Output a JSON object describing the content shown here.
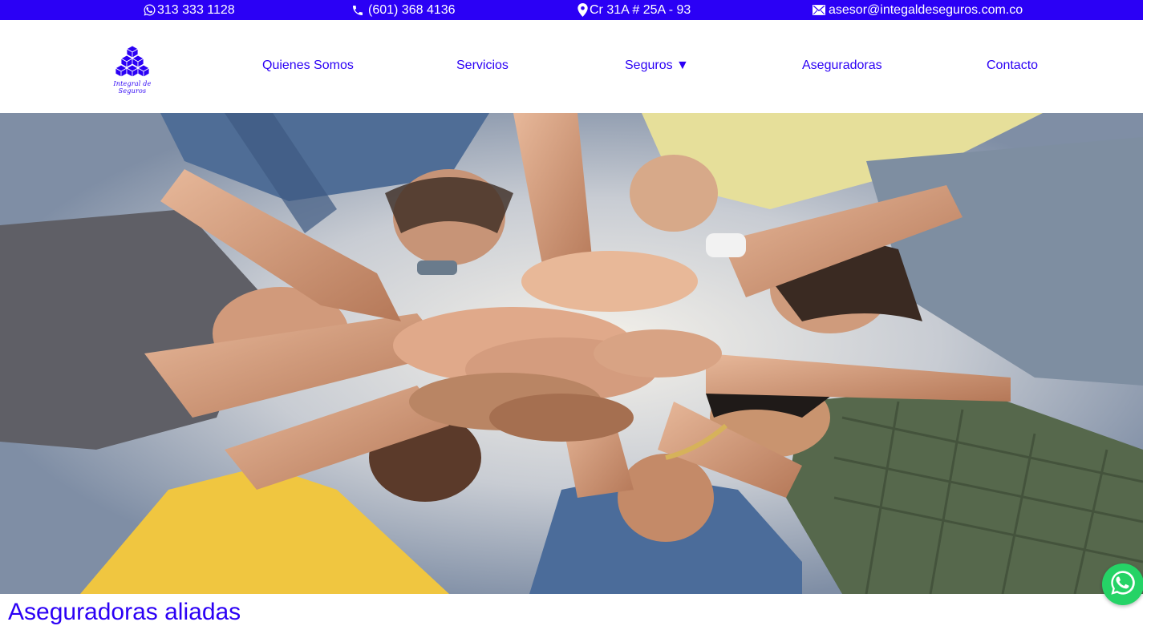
{
  "colors": {
    "brand": "#2b00f5",
    "white": "#ffffff",
    "whatsapp": "#25d366"
  },
  "topbar": {
    "whatsapp": {
      "icon": "whatsapp-icon",
      "text": "313 333 1128"
    },
    "phone": {
      "icon": "phone-icon",
      "text": "(601) 368 4136"
    },
    "address": {
      "icon": "map-pin-icon",
      "text": "Cr 31A # 25A - 93"
    },
    "email": {
      "icon": "mail-icon",
      "text": "asesor@integaldeseguros.com.co"
    }
  },
  "logo": {
    "script_text": "Integral de Seguros"
  },
  "nav": {
    "items": [
      {
        "label": "Quienes Somos"
      },
      {
        "label": "Servicios"
      },
      {
        "label": "Seguros ▼"
      },
      {
        "label": "Aseguradoras"
      },
      {
        "label": "Contacto"
      }
    ]
  },
  "hero": {
    "image": "team-hands-photo"
  },
  "section": {
    "title": "Aseguradoras aliadas"
  },
  "floating": {
    "whatsapp_icon": "whatsapp-icon"
  }
}
